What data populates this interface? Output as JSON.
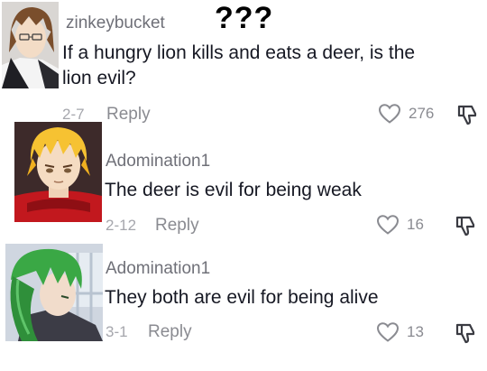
{
  "annotation": "???",
  "comments": [
    {
      "username": "zinkeybucket",
      "text_line1": "If a hungry lion kills and eats a deer, is the",
      "text_line2": "lion evil?",
      "date": "2-7",
      "reply_label": "Reply",
      "likes": "276",
      "avatar_icon": "brown-hair-anime-boy-avatar"
    },
    {
      "username": "Adomination1",
      "text": "The deer is evil for being weak",
      "date": "2-12",
      "reply_label": "Reply",
      "likes": "16",
      "avatar_icon": "blonde-anime-boy-avatar"
    },
    {
      "username": "Adomination1",
      "text": "They both are evil for being alive",
      "date": "3-1",
      "reply_label": "Reply",
      "likes": "13",
      "avatar_icon": "green-hair-anime-avatar"
    }
  ],
  "colors": {
    "text": "#161823",
    "muted": "#8a8b91",
    "username": "#6f7078"
  }
}
